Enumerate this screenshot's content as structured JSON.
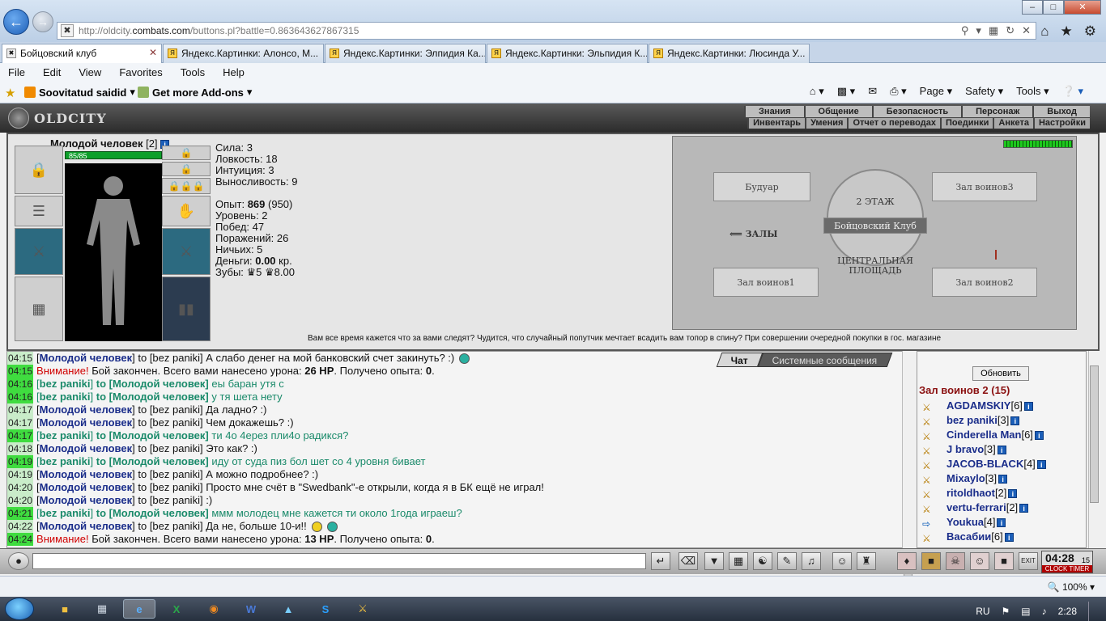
{
  "browser": {
    "url_prefix": "http://oldcity.",
    "url_domain": "combats.com",
    "url_path": "/buttons.pl?battle=0.863643627867315",
    "tabs": [
      {
        "label": "Бойцовский клуб"
      },
      {
        "label": "Яндекс.Картинки: Алонсо, М..."
      },
      {
        "label": "Яндекс.Картинки: Элпидия Ка..."
      },
      {
        "label": "Яндекс.Картинки: Эльпидия К..."
      },
      {
        "label": "Яндекс.Картинки: Люсинда У..."
      }
    ],
    "menu": [
      "File",
      "Edit",
      "View",
      "Favorites",
      "Tools",
      "Help"
    ],
    "fav_items": [
      "Soovitatud saidid",
      "Get more Add-ons"
    ],
    "cmd_items": [
      "Page",
      "Safety",
      "Tools"
    ]
  },
  "game": {
    "logo": "OLDCITY",
    "nav_row1": [
      "Знания",
      "Общение",
      "Безопасность",
      "Персонаж",
      "Выход"
    ],
    "nav_row2": [
      "Инвентарь",
      "Умения",
      "Отчет о переводах",
      "Поединки",
      "Анкета",
      "Настройки"
    ],
    "player": {
      "name": "Молодой человек",
      "level_tag": "[2]",
      "hp": "85/85"
    },
    "stats": {
      "sila": "Сила: 3",
      "lovk": "Ловкость: 18",
      "intu": "Интуиция: 3",
      "vynos": "Выносливость: 9",
      "opyt_label": "Опыт:",
      "opyt_val": "869",
      "opyt_next": "(950)",
      "level": "Уровень: 2",
      "wins": "Побед: 47",
      "losses": "Поражений: 26",
      "draws": "Ничьих: 5",
      "money_label": "Деньги:",
      "money_val": "0.00",
      "money_unit": "кр.",
      "teeth": "Зубы: ♛5 ♛8.00"
    },
    "map": {
      "room1": "Будуар",
      "room2": "Зал воинов3",
      "floor": "2 ЭТАЖ",
      "club": "Бойцовский Клуб",
      "halls": "⟸ ЗАЛЫ",
      "central": "ЦЕНТРАЛЬНАЯ ПЛОЩАДЬ",
      "room3": "Зал воинов1",
      "room4": "Зал воинов2"
    },
    "ticker": "Вам все время кажется что за вами следят? Чудится, что случайный попутчик мечтает всадить вам топор в спину? При совершении очередной покупки в гос. магазине"
  },
  "chat": {
    "tabs": [
      "Чат",
      "Системные сообщения"
    ],
    "lines": [
      {
        "time": "04:15",
        "hl": false,
        "kind": "out",
        "from": "Молодой человек",
        "to": "to [bez paniki]",
        "text": "А слабо денег на мой банковский счет закинуть? :)"
      },
      {
        "time": "04:15",
        "hl": true,
        "kind": "warn",
        "head": "Внимание!",
        "text": "Бой закончен. Всего вами нанесено урона:",
        "v1": "26 HP",
        "mid": ". Получено опыта:",
        "v2": "0",
        "end": "."
      },
      {
        "time": "04:16",
        "hl": true,
        "kind": "in",
        "from": "bez paniki",
        "to": "to [Молодой человек]",
        "text": "еы баран утя с"
      },
      {
        "time": "04:16",
        "hl": true,
        "kind": "in",
        "from": "bez paniki",
        "to": "to [Молодой человек]",
        "text": "у тя шета нету"
      },
      {
        "time": "04:17",
        "hl": false,
        "kind": "out",
        "from": "Молодой человек",
        "to": "to [bez paniki]",
        "text": "Да ладно? :)"
      },
      {
        "time": "04:17",
        "hl": false,
        "kind": "out",
        "from": "Молодой человек",
        "to": "to [bez paniki]",
        "text": "Чем докажешь? :)"
      },
      {
        "time": "04:17",
        "hl": true,
        "kind": "in",
        "from": "bez paniki",
        "to": "to [Молодой человек]",
        "text": "ти 4о 4ерез пли4о радикся?"
      },
      {
        "time": "04:18",
        "hl": false,
        "kind": "out",
        "from": "Молодой человек",
        "to": "to [bez paniki]",
        "text": "Это как? :)"
      },
      {
        "time": "04:19",
        "hl": true,
        "kind": "in",
        "from": "bez paniki",
        "to": "to [Молодой человек]",
        "text": "иду от суда пиз бол шет со 4 уровня бивает"
      },
      {
        "time": "04:19",
        "hl": false,
        "kind": "out",
        "from": "Молодой человек",
        "to": "to [bez paniki]",
        "text": "А можно подробнее? :)"
      },
      {
        "time": "04:20",
        "hl": false,
        "kind": "out",
        "from": "Молодой человек",
        "to": "to [bez paniki]",
        "text": "Просто мне счёт в \"Swedbank\"-е открыли, когда я в БК ещё не играл!"
      },
      {
        "time": "04:20",
        "hl": false,
        "kind": "out",
        "from": "Молодой человек",
        "to": "to [bez paniki]",
        "text": ":)"
      },
      {
        "time": "04:21",
        "hl": true,
        "kind": "in",
        "from": "bez paniki",
        "to": "to [Молодой человек]",
        "text": "ммм молодец мне кажется ти около 1года играеш?"
      },
      {
        "time": "04:22",
        "hl": false,
        "kind": "out",
        "from": "Молодой человек",
        "to": "to [bez paniki]",
        "text": "Да не, больше 10-и!!"
      },
      {
        "time": "04:24",
        "hl": true,
        "kind": "warn",
        "head": "Внимание!",
        "text": "Бой закончен. Всего вами нанесено урона:",
        "v1": "13 HP",
        "mid": ". Получено опыта:",
        "v2": "0",
        "end": "."
      }
    ]
  },
  "room": {
    "refresh": "Обновить",
    "title": "Зал воинов 2 (15)",
    "users": [
      {
        "name": "AGDAMSKIY",
        "lvl": "[6]"
      },
      {
        "name": "bez paniki",
        "lvl": "[3]"
      },
      {
        "name": "Cinderella Man",
        "lvl": "[6]"
      },
      {
        "name": "J bravo",
        "lvl": "[3]"
      },
      {
        "name": "JACOB-BLACK",
        "lvl": "[4]"
      },
      {
        "name": "Mixaylo",
        "lvl": "[3]"
      },
      {
        "name": "ritoldhaot",
        "lvl": "[2]"
      },
      {
        "name": "vertu-ferrari",
        "lvl": "[2]"
      },
      {
        "name": "Youkua",
        "lvl": "[4]"
      },
      {
        "name": "Васабии",
        "lvl": "[6]"
      }
    ]
  },
  "clock": {
    "time": "04:28",
    "sec": "15",
    "label": "CLOCK TIMER"
  },
  "status": {
    "zoom": "100%"
  },
  "taskbar": {
    "lang": "RU",
    "time": "2:28"
  }
}
